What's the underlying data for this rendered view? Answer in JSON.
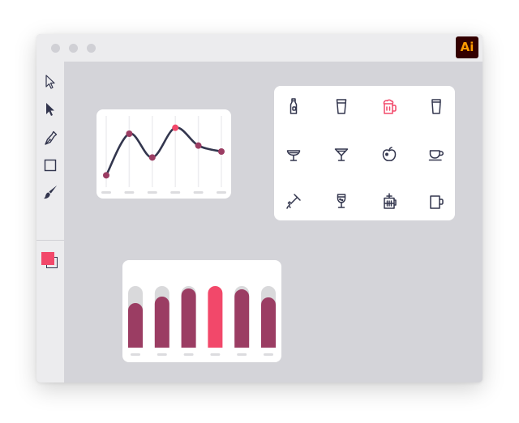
{
  "app": {
    "badge": "Ai",
    "brand_bg": "#330000",
    "brand_fg": "#ff9a00"
  },
  "window": {
    "traffic_lights": [
      "close",
      "minimize",
      "zoom"
    ]
  },
  "tools": [
    {
      "name": "selection-tool",
      "icon": "hollow-arrow-icon"
    },
    {
      "name": "direct-selection-tool",
      "icon": "solid-arrow-icon"
    },
    {
      "name": "pen-tool",
      "icon": "pen-nib-icon"
    },
    {
      "name": "rectangle-tool",
      "icon": "square-icon"
    },
    {
      "name": "brush-tool",
      "icon": "paintbrush-icon"
    }
  ],
  "swatches": {
    "fill": "#f2486a",
    "stroke": "#33364e"
  },
  "colors": {
    "accent": "#f2486a",
    "line": "#33364e",
    "bar": "#9b3d63",
    "bar_track": "#d9d9db",
    "canvas": "#d4d4d9"
  },
  "icon_grid": [
    {
      "name": "bottle-icon",
      "highlight": false
    },
    {
      "name": "glass-icon",
      "highlight": false
    },
    {
      "name": "beer-mug-icon",
      "highlight": true
    },
    {
      "name": "pint-glass-icon",
      "highlight": false
    },
    {
      "name": "champagne-coupe-icon",
      "highlight": false
    },
    {
      "name": "martini-glass-icon",
      "highlight": false
    },
    {
      "name": "apple-icon",
      "highlight": false
    },
    {
      "name": "teacup-icon",
      "highlight": false
    },
    {
      "name": "corkscrew-icon",
      "highlight": false
    },
    {
      "name": "wine-glass-icon",
      "highlight": false
    },
    {
      "name": "french-press-icon",
      "highlight": false
    },
    {
      "name": "mug-icon",
      "highlight": false
    }
  ],
  "chart_data": [
    {
      "type": "line",
      "x": [
        1,
        2,
        3,
        4,
        5,
        6
      ],
      "values": [
        2,
        9,
        5,
        10,
        7,
        6
      ],
      "ylim": [
        0,
        12
      ],
      "highlight_index": 3,
      "grid": true
    },
    {
      "type": "bar",
      "values": [
        55,
        63,
        73,
        76,
        72,
        62
      ],
      "ylim": [
        0,
        76
      ],
      "highlight_index": 3
    }
  ]
}
